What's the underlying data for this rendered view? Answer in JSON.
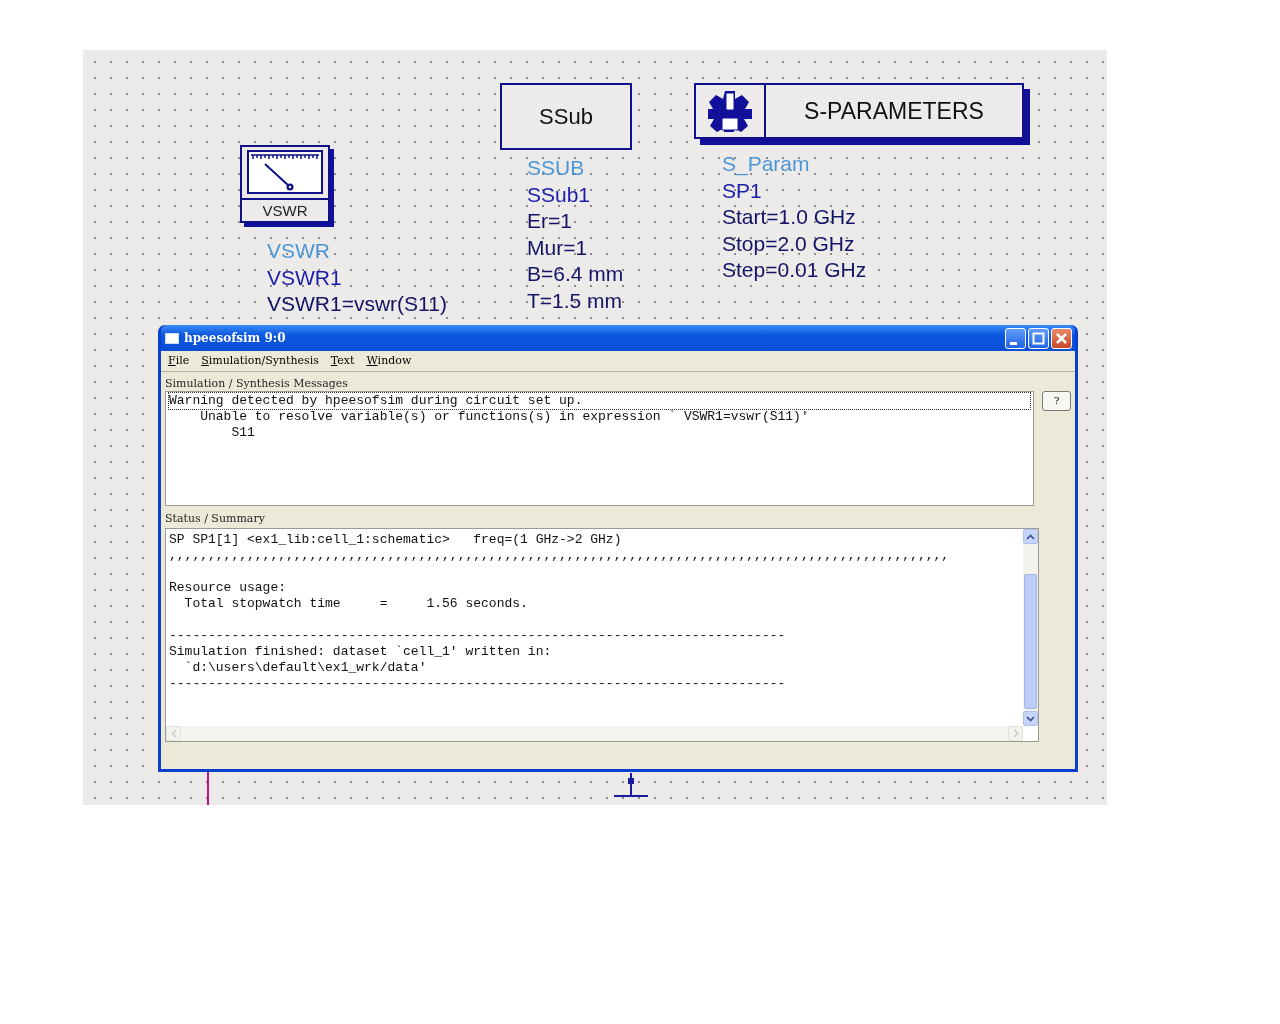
{
  "canvas": {
    "components": [
      {
        "kind": "vswr",
        "symbol_label": "VSWR",
        "lines": [
          {
            "kind": "type",
            "text": "VSWR"
          },
          {
            "kind": "name",
            "text": "VSWR1"
          },
          {
            "kind": "param",
            "text": "VSWR1=vswr(S11)"
          }
        ]
      },
      {
        "kind": "substrate",
        "symbol_label": "SSub",
        "lines": [
          {
            "kind": "type",
            "text": "SSUB"
          },
          {
            "kind": "name",
            "text": "SSub1"
          },
          {
            "kind": "param",
            "text": "Er=1"
          },
          {
            "kind": "param",
            "text": "Mur=1"
          },
          {
            "kind": "param",
            "text": "B=6.4 mm"
          },
          {
            "kind": "param",
            "text": "T=1.5 mm"
          }
        ]
      },
      {
        "kind": "sparams",
        "symbol_label": "S-PARAMETERS",
        "lines": [
          {
            "kind": "type",
            "text": "S_Param"
          },
          {
            "kind": "name",
            "text": "SP1"
          },
          {
            "kind": "param",
            "text": "Start=1.0 GHz"
          },
          {
            "kind": "param",
            "text": "Stop=2.0 GHz"
          },
          {
            "kind": "param",
            "text": "Step=0.01 GHz"
          }
        ]
      }
    ]
  },
  "window": {
    "title": "hpeesofsim 9:0",
    "menu": [
      "File",
      "Simulation/Synthesis",
      "Text",
      "Window"
    ],
    "messages_label": "Simulation / Synthesis Messages",
    "messages": [
      {
        "text": "Warning detected by hpeesofsim during circuit set up.",
        "focused": true
      },
      {
        "text": "    Unable to resolve variable(s) or functions(s) in expression ` VSWR1=vswr(S11)'",
        "focused": false
      },
      {
        "text": "        S11",
        "focused": false
      }
    ],
    "help_button": "?",
    "status_label": "Status / Summary",
    "status_blocks": [
      [
        "SP SP1[1] <ex1_lib:cell_1:schematic>   freq=(1 GHz->2 GHz)",
        ",,,,,,,,,,,,,,,,,,,,,,,,,,,,,,,,,,,,,,,,,,,,,,,,,,,,,,,,,,,,,,,,,,,,,,,,,,,,,,,,,,,,,,,,,,,,,,,,,,,,"
      ],
      [
        "Resource usage:",
        "  Total stopwatch time     =     1.56 seconds."
      ],
      [
        "-------------------------------------------------------------------------------",
        "Simulation finished: dataset `cell_1' written in:",
        "  `d:\\users\\default\\ex1_wrk/data'",
        "-------------------------------------------------------------------------------"
      ]
    ]
  }
}
